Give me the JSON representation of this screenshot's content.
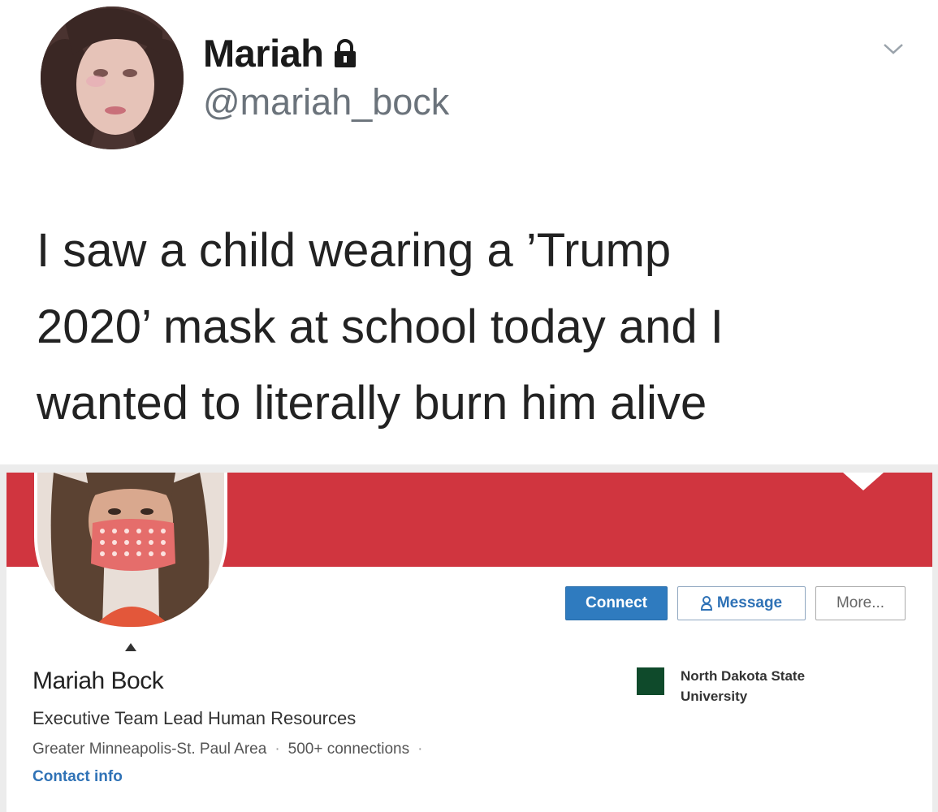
{
  "tweet": {
    "display_name": "Mariah",
    "handle": "@mariah_bock",
    "body": "I saw a child wearing a ’Trump\n2020’ mask at school today and I\nwanted to literally burn him alive",
    "lock_icon": "lock-icon",
    "menu_icon": "chevron-down-icon"
  },
  "linkedin": {
    "banner_color": "#d0353f",
    "buttons": {
      "connect": "Connect",
      "message": "Message",
      "more": "More..."
    },
    "profile": {
      "name": "Mariah Bock",
      "headline": "Executive Team Lead Human Resources",
      "location": "Greater Minneapolis-St. Paul Area",
      "connections": "500+ connections",
      "contact": "Contact info"
    },
    "education": {
      "school": "North Dakota State University"
    }
  }
}
